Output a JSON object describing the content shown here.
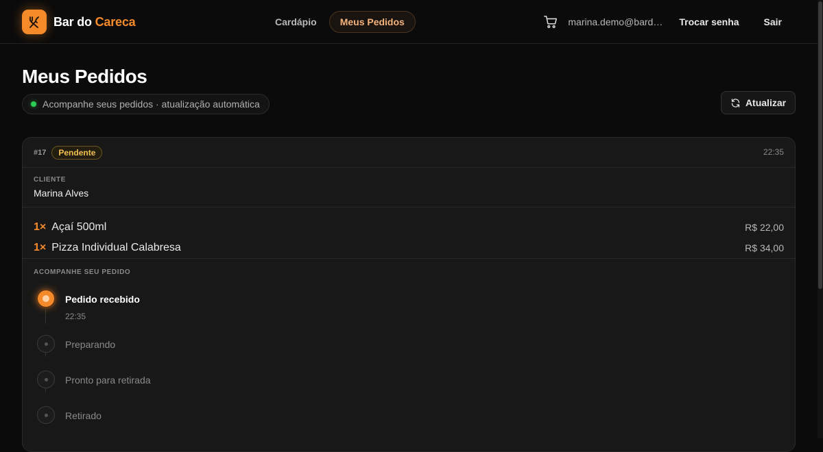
{
  "brand": {
    "name_main": "Bar do ",
    "name_accent": "Careca",
    "accent_color": "#f58a2a"
  },
  "nav": {
    "items": [
      {
        "label": "Cardápio",
        "active": false
      },
      {
        "label": "Meus Pedidos",
        "active": true
      }
    ]
  },
  "header": {
    "cart_icon": "cart-icon",
    "email": "marina.demo@bardocareca.com",
    "change_password": "Trocar senha",
    "logout": "Sair"
  },
  "page": {
    "title": "Meus Pedidos",
    "subtitle": "Acompanhe seus pedidos · atualização automática",
    "refresh_label": "Atualizar"
  },
  "order": {
    "number": "#17",
    "status": "Pendente",
    "time": "22:35",
    "client_label": "CLIENTE",
    "client_name": "Marina Alves",
    "items": [
      {
        "qty": "1×",
        "name": "Açaí 500ml",
        "price": "R$ 22,00"
      },
      {
        "qty": "1×",
        "name": "Pizza Individual Calabresa",
        "price": "R$ 34,00"
      }
    ],
    "tracking_label": "ACOMPANHE SEU PEDIDO",
    "steps": [
      {
        "label": "Pedido recebido",
        "time": "22:35",
        "done": true
      },
      {
        "label": "Preparando",
        "done": false
      },
      {
        "label": "Pronto para retirada",
        "done": false
      },
      {
        "label": "Retirado",
        "done": false
      }
    ]
  }
}
